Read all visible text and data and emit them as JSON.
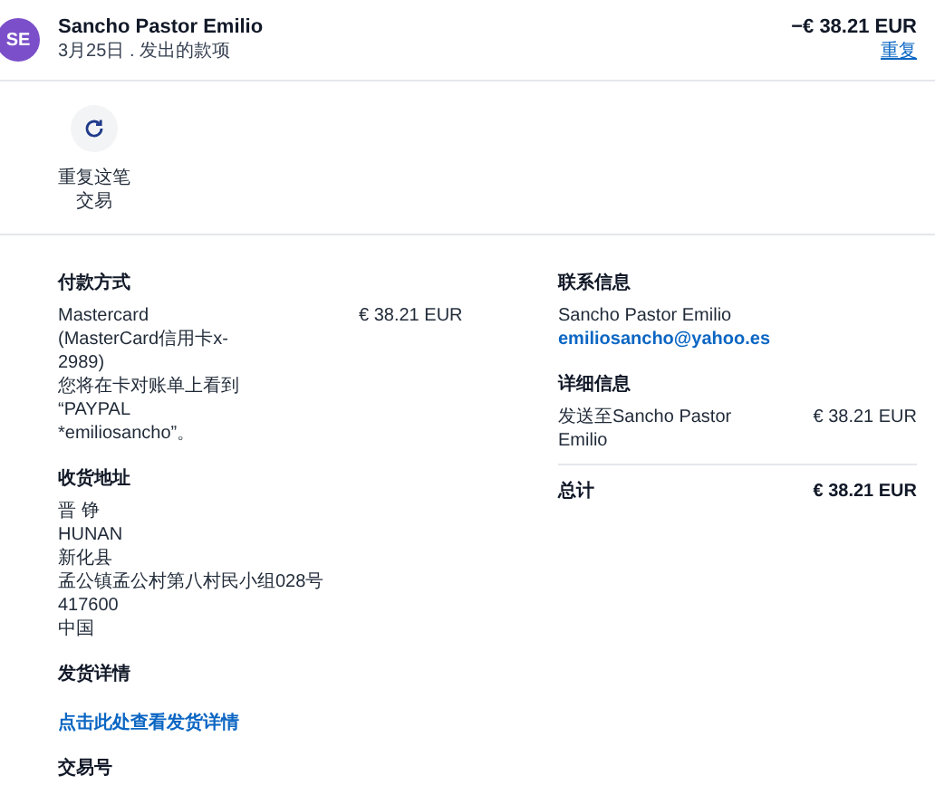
{
  "header": {
    "avatar": "SE",
    "name": "Sancho Pastor Emilio",
    "subtitle": "3月25日 . 发出的款项",
    "amount": "−€ 38.21 EUR",
    "link": "重复"
  },
  "actions": [
    {
      "kind": "repeat",
      "label_lines": [
        "重复这笔",
        "交易"
      ]
    }
  ],
  "payment": {
    "title": "付款方式",
    "lines": [
      "Mastercard",
      "(MasterCard信用卡x-",
      "2989)",
      "您将在卡对账单上看到",
      "“PAYPAL",
      "*emiliosancho”。"
    ],
    "amount": "€ 38.21 EUR"
  },
  "shipping_address": {
    "title": "收货地址",
    "lines": [
      "晋 铮",
      "HUNAN",
      "新化县",
      "孟公镇孟公村第八村民小组028号",
      "417600",
      "中国"
    ]
  },
  "shipping_details": {
    "title": "发货详情",
    "link": "点击此处查看发货详情"
  },
  "transaction_id": {
    "title": "交易号"
  },
  "contact": {
    "title": "联系信息",
    "name": "Sancho Pastor Emilio",
    "email": "emiliosancho@yahoo.es"
  },
  "details": {
    "title": "详细信息",
    "items": [
      {
        "label": "发送至Sancho Pastor Emilio",
        "amount": "€ 38.21 EUR"
      }
    ]
  },
  "total": {
    "label": "总计",
    "amount": "€ 38.21 EUR"
  }
}
